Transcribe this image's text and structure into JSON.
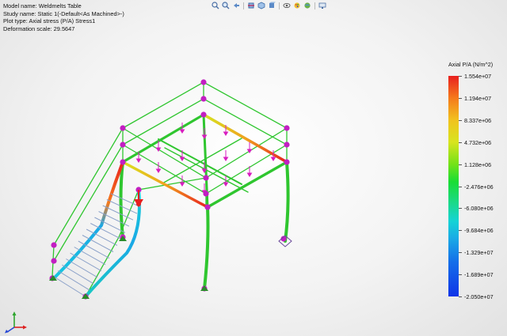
{
  "info": {
    "model_name": "Model name: Weldmelts Table",
    "study_name": "Study name: Static 1(-Default<As Machined>-)",
    "plot_type": "Plot type: Axial stress (P/A) Stress1",
    "deformation_scale": "Deformation scale: 29.5647"
  },
  "toolbar": {
    "icons": [
      "zoom-to-fit-icon",
      "zoom-area-icon",
      "previous-view-icon",
      "section-view-icon",
      "view-orientation-icon",
      "display-style-icon",
      "hide-show-icon",
      "edit-appearance-icon",
      "apply-scene-icon",
      "view-settings-icon",
      "monitor-icon"
    ]
  },
  "legend": {
    "title": "Axial P/A (N/m^2)",
    "labels": [
      "1.554e+07",
      "1.194e+07",
      "8.337e+06",
      "4.732e+06",
      "1.128e+06",
      "-2.476e+06",
      "-6.080e+06",
      "-9.684e+06",
      "-1.329e+07",
      "-1.689e+07",
      "-2.050e+07"
    ]
  },
  "colors": {
    "green": "#2fc62f",
    "node": "#c21fc2",
    "load_arrow": "#d81dbf",
    "red": "#e8201f",
    "blue": "#1034e8"
  }
}
